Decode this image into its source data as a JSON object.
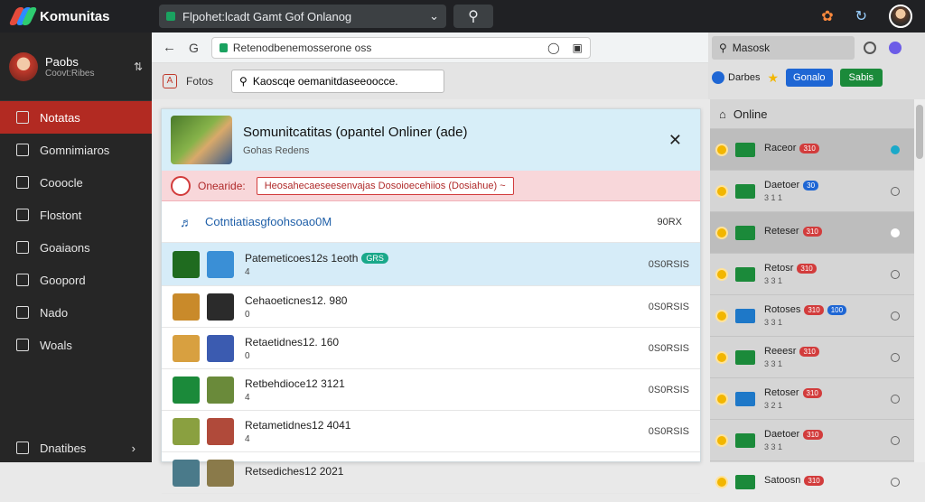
{
  "app": {
    "title": "Komunitas"
  },
  "topbar": {
    "address": "Flpohet:lcadt Gamt Gof Onlanog",
    "search_icon": "search-icon"
  },
  "sidebar": {
    "profile": {
      "name": "Paobs",
      "subtitle": "Coovt:Ribes"
    },
    "items": [
      {
        "label": "Notatas",
        "icon": "list-icon",
        "active": true
      },
      {
        "label": "Gomnimiaros",
        "icon": "chat-icon"
      },
      {
        "label": "Cooocle",
        "icon": "doc-icon"
      },
      {
        "label": "Flostont",
        "icon": "pen-icon"
      },
      {
        "label": "Goaiaons",
        "icon": "doc-icon"
      },
      {
        "label": "Goopord",
        "icon": "board-icon"
      },
      {
        "label": "Nado",
        "icon": "menu-icon"
      },
      {
        "label": "Woals",
        "icon": "chart-icon"
      }
    ],
    "footer": {
      "label": "Dnatibes"
    }
  },
  "browser": {
    "url": "Retenodbenemosserone oss"
  },
  "subbar": {
    "label": "Fotos",
    "search_value": "Kaoscqe oemanitdaseeoocce."
  },
  "panel": {
    "title": "Somunitcatitas (opantel Onliner (ade)",
    "subtitle": "Gohas Redens",
    "alert": {
      "label": "Onearide:",
      "button": "Heosahecaeseesenvajas Dosoioecehiios (Dosiahue) ~"
    },
    "section": {
      "title": "Cotntiatiasgfoohsoao0M",
      "right": "90RX"
    },
    "rows": [
      {
        "name": "Patemeticoes12s 1eoth",
        "badge": "GRS",
        "sub": "4",
        "value": "0S0RSIS",
        "selected": true
      },
      {
        "name": "Cehaoeticnes12. 980",
        "sub": "0",
        "value": "0S0RSIS"
      },
      {
        "name": "Retaetidnes12. 160",
        "sub": "0",
        "value": "0S0RSIS"
      },
      {
        "name": "Retbehdioce12 3121",
        "sub": "4",
        "value": "0S0RSIS"
      },
      {
        "name": "Retametidnes12 4041",
        "sub": "4",
        "value": "0S0RSIS"
      },
      {
        "name": "Retsediches12 2021",
        "sub": "",
        "value": ""
      }
    ]
  },
  "right": {
    "search": "Masosk",
    "label": "Darbes",
    "btn_blue": "Gonalo",
    "btn_green": "Sabis",
    "list_title": "Online",
    "items": [
      {
        "name": "Raceor",
        "pill": "310",
        "pc": "r",
        "sub": "",
        "status": "on",
        "hl": true,
        "blue": false
      },
      {
        "name": "Daetoer",
        "pill": "30",
        "pc": "bl",
        "sub": "3 1 1",
        "status": "",
        "hl": false,
        "blue": false
      },
      {
        "name": "Reteser",
        "pill": "310",
        "pc": "r",
        "sub": "",
        "status": "w",
        "hl": true,
        "blue": false
      },
      {
        "name": "Retosr",
        "pill": "310",
        "pc": "r",
        "sub": "3 3 1",
        "status": "",
        "hl": false,
        "blue": false
      },
      {
        "name": "Rotoses",
        "pill": "310",
        "pc": "r",
        "pill2": "100",
        "sub": "3 3 1",
        "status": "",
        "hl": false,
        "blue": true
      },
      {
        "name": "Reeesr",
        "pill": "310",
        "pc": "r",
        "sub": "3 3 1",
        "status": "",
        "hl": false,
        "blue": false
      },
      {
        "name": "Retoser",
        "pill": "310",
        "pc": "r",
        "sub": "3 2 1",
        "status": "",
        "hl": false,
        "blue": true
      },
      {
        "name": "Daetoer",
        "pill": "310",
        "pc": "r",
        "sub": "3 3 1",
        "status": "",
        "hl": false,
        "blue": false
      },
      {
        "name": "Satoosn",
        "pill": "310",
        "pc": "r",
        "sub": "",
        "status": "",
        "hl": false,
        "blue": false
      }
    ]
  }
}
